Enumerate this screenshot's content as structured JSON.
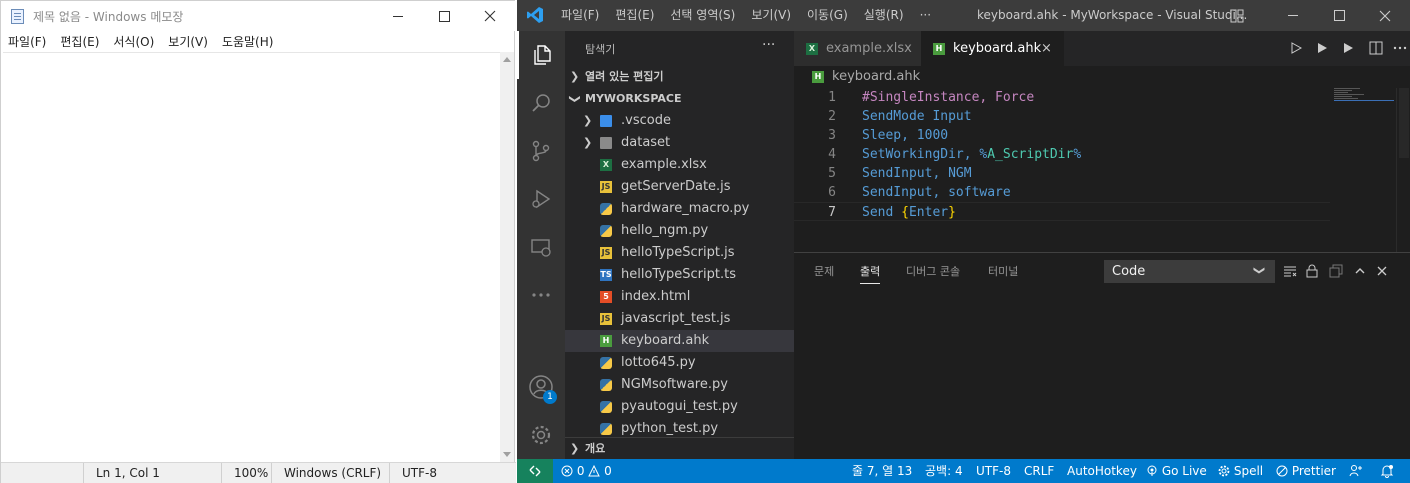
{
  "notepad": {
    "title": "제목 없음 - Windows 메모장",
    "menu": [
      "파일(F)",
      "편집(E)",
      "서식(O)",
      "보기(V)",
      "도움말(H)"
    ],
    "content": "",
    "status": {
      "position": "Ln 1, Col 1",
      "zoom": "100%",
      "line_ending": "Windows (CRLF)",
      "encoding": "UTF-8"
    }
  },
  "vscode": {
    "title": "keyboard.ahk - MyWorkspace - Visual Studi...",
    "menu": [
      "파일(F)",
      "편집(E)",
      "선택 영역(S)",
      "보기(V)",
      "이동(G)",
      "실행(R)",
      "···"
    ],
    "sidebar": {
      "title": "탐색기",
      "more": "···",
      "open_editors": "열려 있는 편집기",
      "workspace": "MYWORKSPACE",
      "outline": "개요",
      "files": [
        {
          "name": ".vscode",
          "icon": "vscode-folder-icon",
          "folder": true
        },
        {
          "name": "dataset",
          "icon": "folder-icon",
          "folder": true
        },
        {
          "name": "example.xlsx",
          "icon": "excel-file-icon",
          "badge": "X"
        },
        {
          "name": "getServerDate.js",
          "icon": "js-file-icon",
          "badge": "JS"
        },
        {
          "name": "hardware_macro.py",
          "icon": "python-file-icon",
          "badge": ""
        },
        {
          "name": "hello_ngm.py",
          "icon": "python-file-icon",
          "badge": ""
        },
        {
          "name": "helloTypeScript.js",
          "icon": "js-file-icon",
          "badge": "JS"
        },
        {
          "name": "helloTypeScript.ts",
          "icon": "ts-file-icon",
          "badge": "TS"
        },
        {
          "name": "index.html",
          "icon": "html-file-icon",
          "badge": "5"
        },
        {
          "name": "javascript_test.js",
          "icon": "js-file-icon",
          "badge": "JS"
        },
        {
          "name": "keyboard.ahk",
          "icon": "ahk-file-icon",
          "badge": "H",
          "selected": true
        },
        {
          "name": "lotto645.py",
          "icon": "python-file-icon",
          "badge": ""
        },
        {
          "name": "NGMsoftware.py",
          "icon": "python-file-icon",
          "badge": ""
        },
        {
          "name": "pyautogui_test.py",
          "icon": "python-file-icon",
          "badge": ""
        },
        {
          "name": "python_test.py",
          "icon": "python-file-icon",
          "badge": ""
        }
      ]
    },
    "account_badge": "1",
    "tabs": [
      {
        "label": "example.xlsx",
        "badge": "X",
        "active": false
      },
      {
        "label": "keyboard.ahk",
        "badge": "H",
        "active": true
      }
    ],
    "tab_close": "×",
    "breadcrumb": {
      "icon_badge": "H",
      "file": "keyboard.ahk"
    },
    "code": [
      {
        "n": "1",
        "parts": [
          {
            "t": "#SingleInstance, Force",
            "c": "dir"
          }
        ]
      },
      {
        "n": "2",
        "parts": [
          {
            "t": "SendMode Input",
            "c": "kw"
          }
        ]
      },
      {
        "n": "3",
        "parts": [
          {
            "t": "Sleep, 1000",
            "c": "kw"
          }
        ]
      },
      {
        "n": "4",
        "parts": [
          {
            "t": "SetWorkingDir, %",
            "c": "kw"
          },
          {
            "t": "A_ScriptDir",
            "c": "var"
          },
          {
            "t": "%",
            "c": "kw"
          }
        ]
      },
      {
        "n": "5",
        "parts": [
          {
            "t": "SendInput, NGM",
            "c": "kw"
          }
        ]
      },
      {
        "n": "6",
        "parts": [
          {
            "t": "SendInput, software",
            "c": "kw"
          }
        ]
      },
      {
        "n": "7",
        "parts": [
          {
            "t": "Send ",
            "c": "kw"
          },
          {
            "t": "{",
            "c": "brace"
          },
          {
            "t": "Enter",
            "c": "kw"
          },
          {
            "t": "}",
            "c": "brace"
          }
        ]
      }
    ],
    "current_line": "7",
    "panel": {
      "tabs": [
        "문제",
        "출력",
        "디버그 콘솔",
        "터미널"
      ],
      "active_tab": "출력",
      "output_channel": "Code"
    },
    "status": {
      "errors": "0",
      "warnings": "0",
      "position": "줄 7, 열 13",
      "indent": "공백: 4",
      "encoding": "UTF-8",
      "eol": "CRLF",
      "language": "AutoHotkey",
      "go_live": "Go Live",
      "spell": "Spell",
      "prettier": "Prettier"
    },
    "colors": {
      "title_bar": "#3c3c3c",
      "activity_bar": "#333333",
      "sidebar": "#252526",
      "editor": "#1e1e1e",
      "status_bar": "#007acc",
      "remote": "#16825d"
    }
  }
}
